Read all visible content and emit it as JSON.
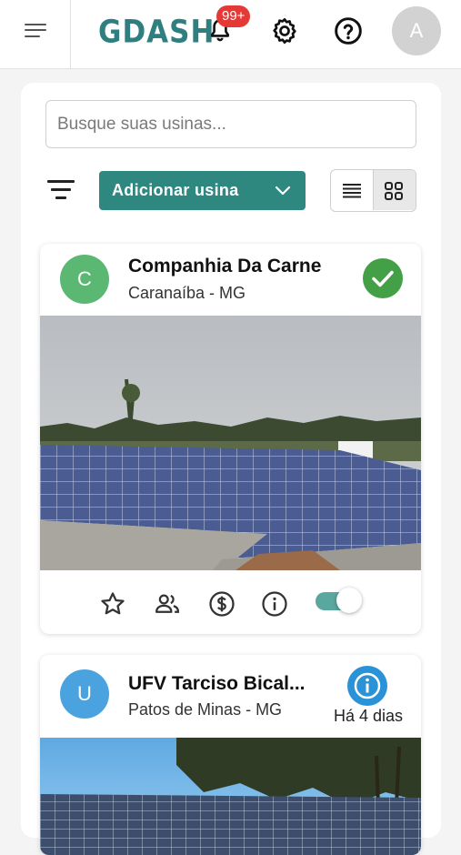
{
  "header": {
    "logo": "GDASH",
    "notifications_badge": "99+",
    "user_initial": "A"
  },
  "search": {
    "placeholder": "Busque suas usinas..."
  },
  "toolbar": {
    "add_label": "Adicionar usina"
  },
  "plants": [
    {
      "initial": "C",
      "name": "Companhia Da Carne",
      "location": "Caranaíba - MG",
      "avatar_color": "#5bb872",
      "status": "ok",
      "status_color": "#43a047",
      "monitoring_enabled": true
    },
    {
      "initial": "U",
      "name": "UFV Tarciso Bical...",
      "location": "Patos de Minas - MG",
      "avatar_color": "#4aa3df",
      "status": "info",
      "status_color": "#2a92d6",
      "last_update": "Há 4 dias"
    }
  ],
  "colors": {
    "brand": "#2f7f80",
    "accent": "#2f8880",
    "badge": "#e53935"
  }
}
